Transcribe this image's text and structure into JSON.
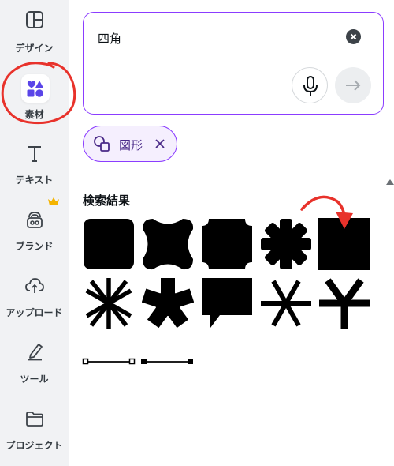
{
  "sidebar": {
    "items": [
      {
        "label": "デザイン",
        "icon": "template-icon"
      },
      {
        "label": "素材",
        "icon": "elements-icon"
      },
      {
        "label": "テキスト",
        "icon": "text-icon"
      },
      {
        "label": "ブランド",
        "icon": "brand-icon"
      },
      {
        "label": "アップロード",
        "icon": "upload-cloud-icon"
      },
      {
        "label": "ツール",
        "icon": "draw-tool-icon"
      },
      {
        "label": "プロジェクト",
        "icon": "folder-icon"
      }
    ],
    "active_index": 1
  },
  "search": {
    "value": "四角"
  },
  "filter_chip": {
    "label": "図形",
    "icon": "shapes-icon"
  },
  "results": {
    "title": "検索結果",
    "shape_count": 10,
    "line_count": 2
  },
  "colors": {
    "accent": "#8b3dff",
    "brand_element_icon": "#5a45e8",
    "annotation_red": "#e8322b",
    "crown_gold": "#f4b400"
  }
}
